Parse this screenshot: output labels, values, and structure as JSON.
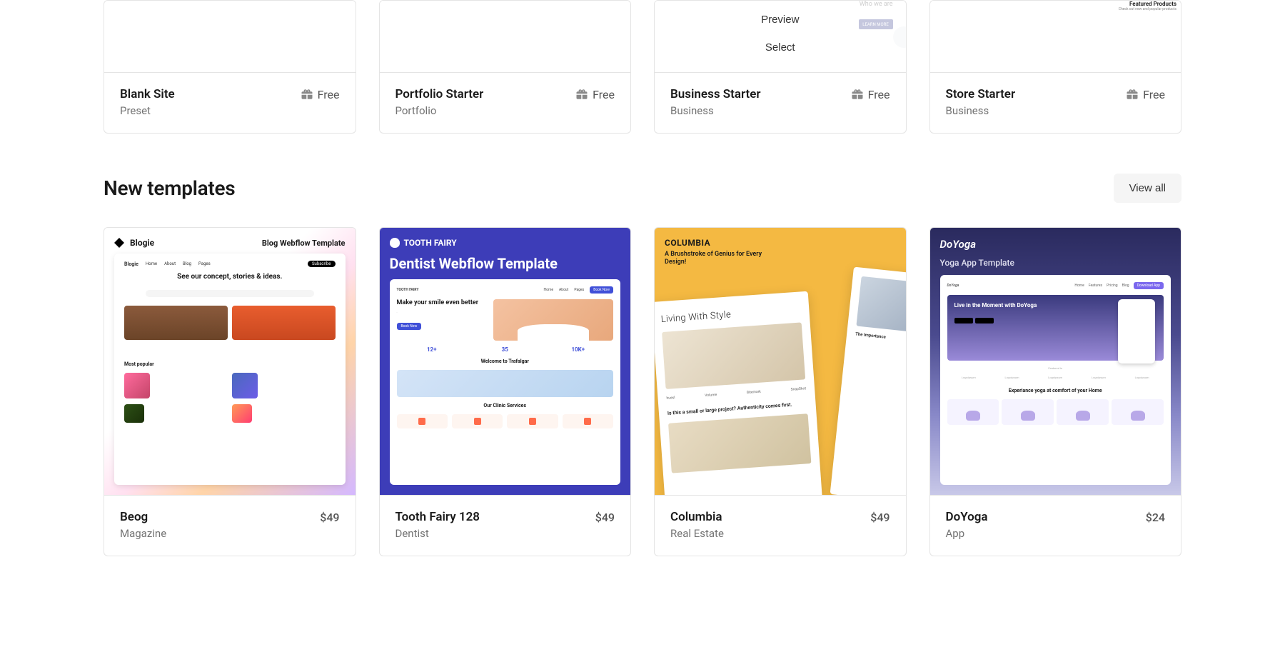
{
  "top_cards": [
    {
      "title": "Blank Site",
      "category": "Preset",
      "price_label": "Free"
    },
    {
      "title": "Portfolio Starter",
      "category": "Portfolio",
      "price_label": "Free"
    },
    {
      "title": "Business Starter",
      "category": "Business",
      "price_label": "Free"
    },
    {
      "title": "Store Starter",
      "category": "Business",
      "price_label": "Free"
    }
  ],
  "business_overlay": {
    "preview_label": "Preview",
    "select_label": "Select",
    "who_label": "Who we are",
    "learn_more": "LEARN MORE"
  },
  "store_thumb": {
    "heading": "Featured Products",
    "sub": "Check out new and popular products"
  },
  "section": {
    "title": "New templates",
    "view_all_label": "View all"
  },
  "new_cards": [
    {
      "title": "Beog",
      "category": "Magazine",
      "price": "$49"
    },
    {
      "title": "Tooth Fairy 128",
      "category": "Dentist",
      "price": "$49"
    },
    {
      "title": "Columbia",
      "category": "Real Estate",
      "price": "$49"
    },
    {
      "title": "DoYoga",
      "category": "App",
      "price": "$24"
    }
  ],
  "thumb_beog": {
    "logo": "Blogie",
    "tag": "Blog Webflow Template",
    "hero": "See our concept, stories & ideas.",
    "popular": "Most popular"
  },
  "thumb_tooth": {
    "logo": "TOOTH FAIRY",
    "title": "Dentist Webflow Template",
    "hero": "Make your smile even better",
    "stats": [
      {
        "n": "12+",
        "l": ""
      },
      {
        "n": "35",
        "l": ""
      },
      {
        "n": "10K+",
        "l": ""
      }
    ],
    "welcome": "Welcome to Trafalgar",
    "services": "Our Clinic Services"
  },
  "thumb_columbia": {
    "brand": "COLUMBIA",
    "sub": "A Brushstroke of Genius for Every Design!",
    "hero": "Living With Style",
    "q": "Is this a small or large project? Authenticity comes first.",
    "logos": [
      "huesl",
      "Volume",
      "Bitemark",
      "SnapShot"
    ],
    "importance": "The Importance"
  },
  "thumb_doyoga": {
    "brand": "DoYoga",
    "sub": "Yoga App Template",
    "hero": "Live in the Moment with DoYoga",
    "featured": "Featured in",
    "logos": [
      "Logoipsum",
      "Logoipsum",
      "Logoipsum",
      "Logoipsum",
      "Logoipsum"
    ],
    "experience": "Experiance yoga at comfort of your Home"
  }
}
